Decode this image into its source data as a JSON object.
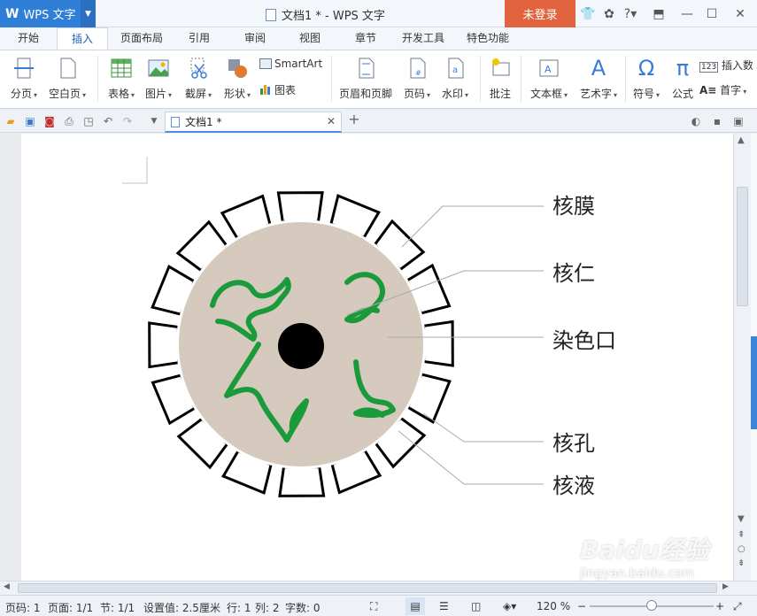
{
  "titlebar": {
    "app_name": "WPS 文字",
    "doc_title": "文档1 * - WPS 文字",
    "login_label": "未登录"
  },
  "tabs": [
    "开始",
    "插入",
    "页面布局",
    "引用",
    "审阅",
    "视图",
    "章节",
    "开发工具",
    "特色功能"
  ],
  "active_tab": "插入",
  "ribbon": {
    "page_break": "分页",
    "blank_page": "空白页",
    "table": "表格",
    "picture": "图片",
    "screenshot": "截屏",
    "shape": "形状",
    "smartart": "SmartArt",
    "chart": "图表",
    "header_footer": "页眉和页脚",
    "page_number": "页码",
    "watermark": "水印",
    "comment": "批注",
    "textbox": "文本框",
    "wordart": "艺术字",
    "symbol": "符号",
    "formula": "公式",
    "insert_number": "插入数",
    "drop_cap": "首字"
  },
  "doc_tab": {
    "label": "文档1 *"
  },
  "diagram": {
    "labels": {
      "membrane": "核膜",
      "nucleolus": "核仁",
      "chromatin": "染色口",
      "pore": "核孔",
      "sap": "核液"
    },
    "colors": {
      "nucleoplasm": "#d8ccc0",
      "chromatin": "#1a9a3a",
      "nucleolus": "#000000",
      "membrane_segment": "#ffffff",
      "leader_line": "#aaaaaa"
    }
  },
  "status": {
    "page": "页码: 1",
    "pages": "页面: 1/1",
    "section": "节: 1/1",
    "setting": "设置值: 2.5厘米",
    "row": "行: 1",
    "col": "列: 2",
    "words": "字数: 0",
    "zoom": "120 %"
  },
  "watermark": {
    "brand": "Baidu经验",
    "url": "jingyan.baidu.com"
  }
}
